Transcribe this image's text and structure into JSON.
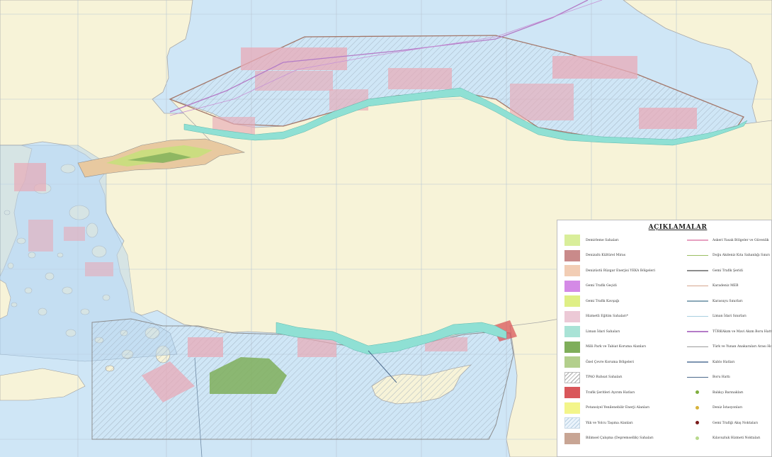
{
  "legend": {
    "title": "AÇIKLAMALAR",
    "left_items": [
      {
        "label": "Demirleme Sahaları",
        "icon": "demirleme-swatch",
        "color": "#d9ee9a"
      },
      {
        "label": "Denizaltı Kültürel Miras",
        "icon": "kulturel-miras-swatch",
        "color": "#c98a8a"
      },
      {
        "label": "Denizüstü Rüzgar Enerjisi YEKA Bölgeleri",
        "icon": "ruzgar-yeka-swatch",
        "color": "#f2cdb4"
      },
      {
        "label": "Gemi Trafik Geçidi",
        "icon": "trafik-gecidi-swatch",
        "color": "#d48ae6"
      },
      {
        "label": "Gemi Trafik Kavşağı",
        "icon": "trafik-kavsagi-swatch",
        "color": "#dfef85"
      },
      {
        "label": "Hizmetli Eğitim Sahaları*",
        "icon": "egitim-sahalari-swatch",
        "color": "#ecc9d6"
      },
      {
        "label": "Liman İdari Sahaları",
        "icon": "liman-idari-swatch",
        "color": "#a9e3d6"
      },
      {
        "label": "Milli Park ve Tabiat Koruma Alanları",
        "icon": "milli-park-swatch",
        "color": "#7fae5a"
      },
      {
        "label": "Özel Çevre Koruma Bölgeleri",
        "icon": "ozel-cevre-swatch",
        "color": "#b3cf8c"
      },
      {
        "label": "TPAO Ruhsat Sahaları",
        "icon": "tpao-ruhsat-swatch",
        "color": "hatch"
      },
      {
        "label": "Trafik Şeritleri Ayırım Hatları",
        "icon": "trafik-seritleri-swatch",
        "color": "#d9575a"
      },
      {
        "label": "Potansiyel Yenilenebilir Enerji Alanları",
        "icon": "yenilenebilir-swatch",
        "color": "#f3f58a"
      },
      {
        "label": "Yük ve Yolcu Taşıma Alanları",
        "icon": "yuk-yolcu-swatch",
        "color": "hatch-blue"
      },
      {
        "label": "Bilimsel Çalışma (Depremsellik) Sahaları",
        "icon": "bilimsel-calisma-swatch",
        "color": "#c8a594"
      }
    ],
    "right_items": [
      {
        "label": "Askeri Yasak Bölgeler ve Güvenlik",
        "icon": "askeri-yasak-line",
        "color": "#e7a0c0"
      },
      {
        "label": "Doğu Akdeniz Kıta Sahanlığı Sınırı",
        "icon": "kita-sahanligi-line",
        "color": "#9bbf63"
      },
      {
        "label": "Gemi Trafik Şeridi",
        "icon": "trafik-seridi-line",
        "color": "#8d8d8d"
      },
      {
        "label": "Karadeniz MEB",
        "icon": "karadeniz-meb-line",
        "color": "#d6a58e"
      },
      {
        "label": "Karasuyu Sınırları",
        "icon": "karasuyu-line",
        "color": "#8aa8b8"
      },
      {
        "label": "Liman İdari Sınırları",
        "icon": "liman-idari-line",
        "color": "#a9d0e0"
      },
      {
        "label": "TÜRKAkım ve Mavi Akım Boru Hattı",
        "icon": "turkakim-line",
        "color": "#b47cc7"
      },
      {
        "label": "Türk ve Yunan Anakaraları Arası Hat",
        "icon": "turk-yunan-line",
        "color": "#9a9a9a"
      },
      {
        "label": "Kablo Hatları",
        "icon": "kablo-line",
        "color": "#7d94b0"
      },
      {
        "label": "Boru Hattı",
        "icon": "boru-hatti-line",
        "color": "#4c6a8c"
      },
      {
        "label": "Balıkçı Barınakları",
        "icon": "balikci-barinak-point",
        "color": "#7fae3e"
      },
      {
        "label": "Deniz İstasyonları",
        "icon": "deniz-istasyon-point",
        "color": "#d7b23a"
      },
      {
        "label": "Gemi Trafiği Akış Noktaları",
        "icon": "trafik-akis-point",
        "color": "#7a1a1a"
      },
      {
        "label": "Kılavuzluk Hizmeti Noktaları",
        "icon": "kilavuzluk-point",
        "color": "#b8d98c"
      }
    ]
  },
  "colors": {
    "sea": "#cfe6f6",
    "land": "#f7f3d8",
    "grid": "#b7c7d3",
    "border": "#8f8f8f",
    "liman_band": "#8fe0d4",
    "exercise": "#e8aab7",
    "meb": "#a3776a"
  }
}
